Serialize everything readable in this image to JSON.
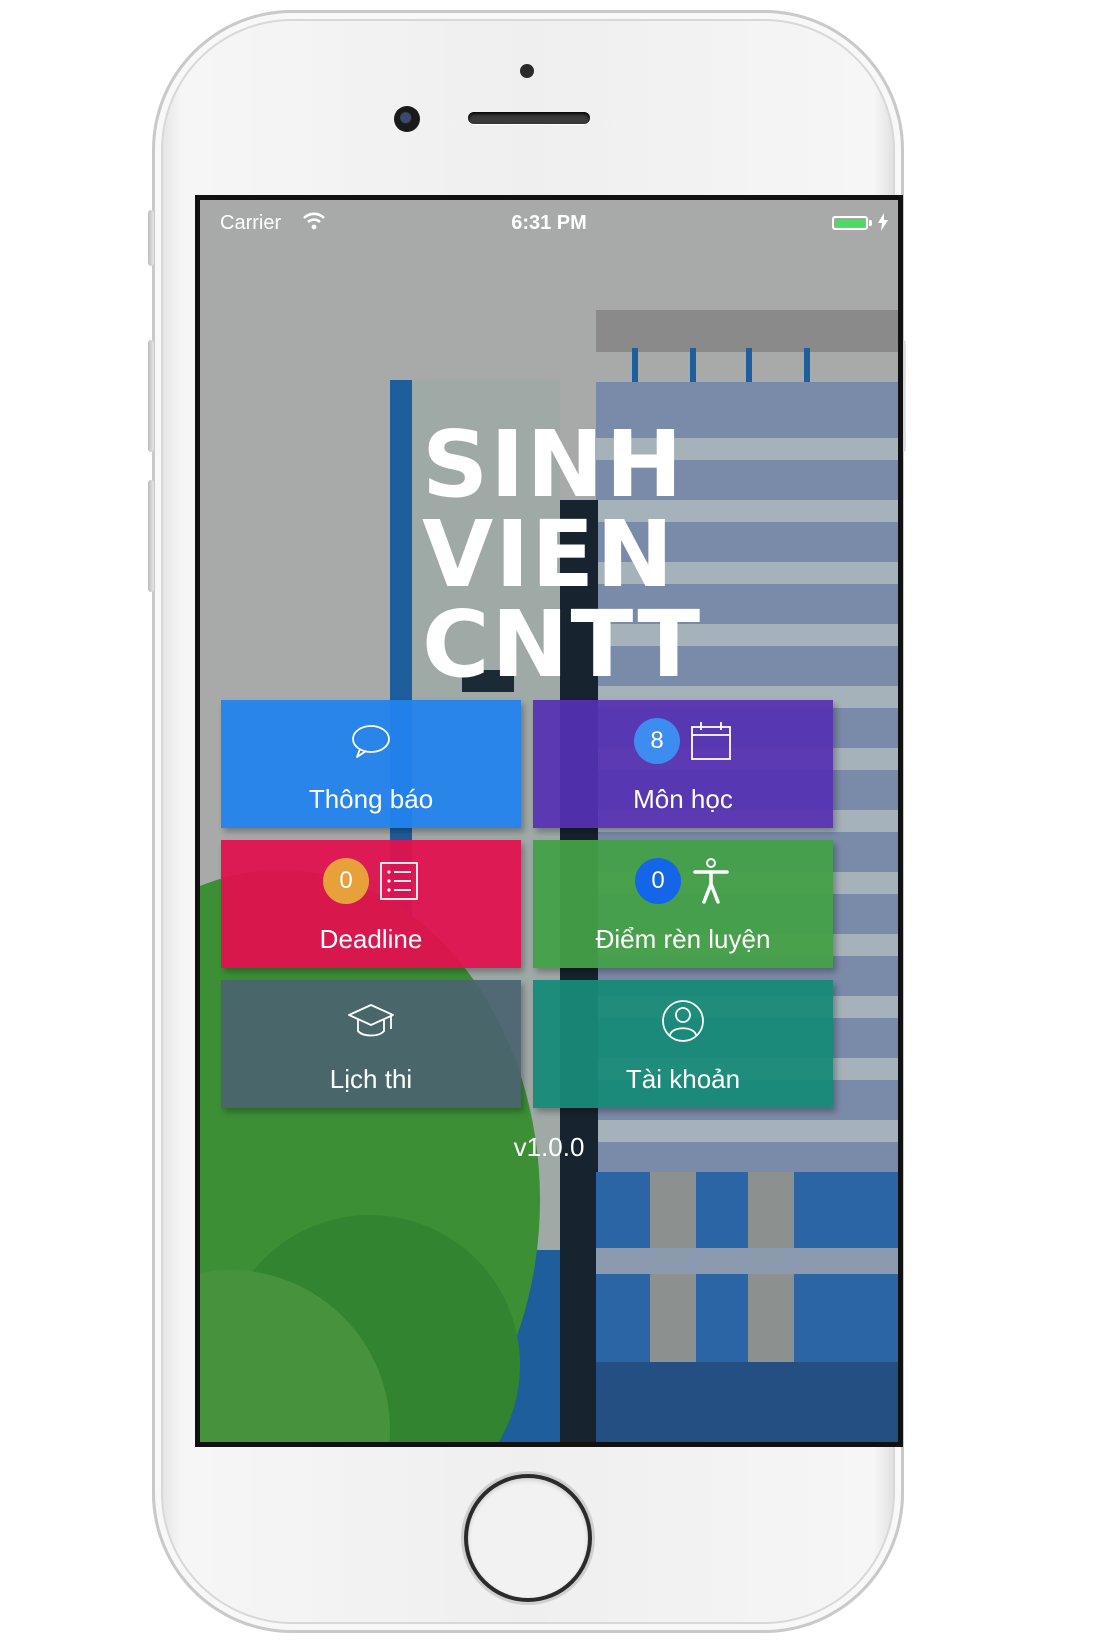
{
  "status_bar": {
    "carrier": "Carrier",
    "time": "6:31 PM"
  },
  "logo": {
    "line1": "SINH",
    "line2": "VIEN",
    "line3": "CNTT"
  },
  "tiles": [
    {
      "label": "Thông báo",
      "icon": "chat-bubble-icon",
      "color": "#2283ee",
      "badge": null
    },
    {
      "label": "Môn học",
      "icon": "calendar-icon",
      "color": "#5530b4",
      "badge": "8",
      "badge_color": "#3d8cf0"
    },
    {
      "label": "Deadline",
      "icon": "checklist-icon",
      "color": "#e0124f",
      "badge": "0",
      "badge_color": "#e8a03a"
    },
    {
      "label": "Điểm rèn luyện",
      "icon": "person-icon",
      "color": "#43a047",
      "badge": "0",
      "badge_color": "#1565e8"
    },
    {
      "label": "Lịch thi",
      "icon": "graduation-cap-icon",
      "color": "#4a6470",
      "badge": null
    },
    {
      "label": "Tài khoản",
      "icon": "user-circle-icon",
      "color": "#178a78",
      "badge": null
    }
  ],
  "version": "v1.0.0"
}
